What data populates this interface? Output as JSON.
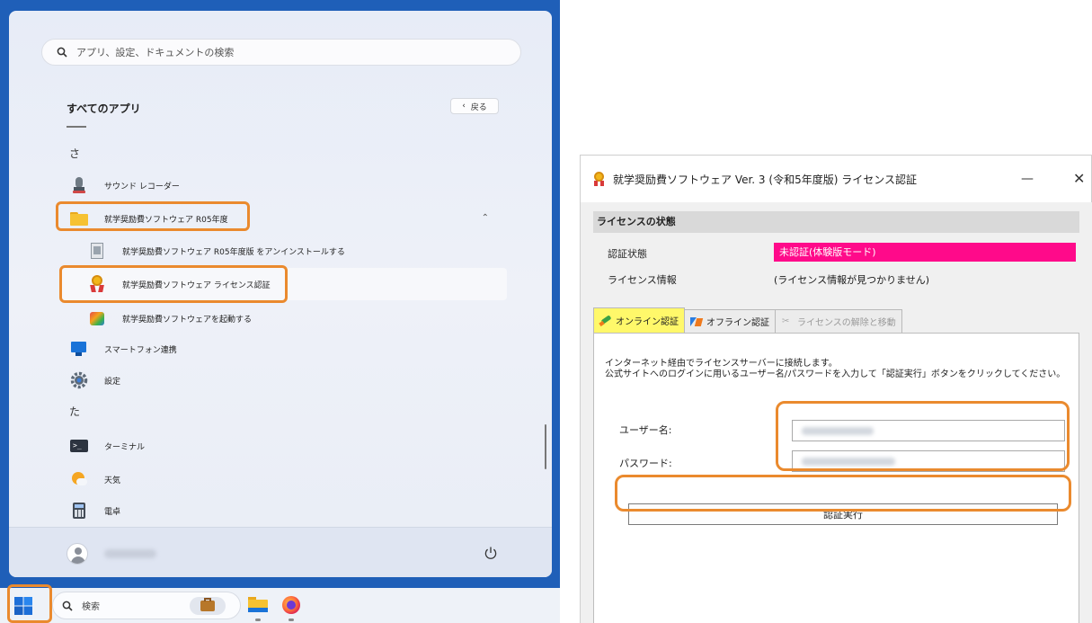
{
  "start_menu": {
    "search_placeholder": "アプリ、設定、ドキュメントの検索",
    "all_apps_title": "すべてのアプリ",
    "back_label": "戻る",
    "letters": [
      "さ",
      "た"
    ],
    "apps": {
      "sound_recorder": "サウンド レコーダー",
      "folder": "就学奨励費ソフトウェア R05年度",
      "uninstall": "就学奨励費ソフトウェア R05年度版 をアンインストールする",
      "license": "就学奨励費ソフトウェア ライセンス認証",
      "launch": "就学奨励費ソフトウェアを起動する",
      "phone_link": "スマートフォン連携",
      "settings": "設定",
      "terminal": "ターミナル",
      "weather": "天気",
      "calculator": "電卓"
    }
  },
  "taskbar": {
    "search_label": "検索"
  },
  "dialog": {
    "title": "就学奨励費ソフトウェア Ver. 3 (令和5年度版) ライセンス認証",
    "section_header": "ライセンスの状態",
    "auth_status_label": "認証状態",
    "auth_status_value": "未認証(体験版モード)",
    "license_info_label": "ライセンス情報",
    "license_info_value": "(ライセンス情報が見つかりません)",
    "tabs": [
      "オンライン認証",
      "オフライン認証",
      "ライセンスの解除と移動"
    ],
    "description": "インターネット経由でライセンスサーバーに接続します。\n公式サイトへのログインに用いるユーザー名/パスワードを入力して「認証実行」ボタンをクリックしてください。",
    "username_label": "ユーザー名:",
    "password_label": "パスワード:",
    "execute_button": "認証実行"
  },
  "colors": {
    "callout": "#ea8a2e",
    "status_bg": "#ff0a8a",
    "active_tab": "#fff86a",
    "desktop": "#1f5fb8"
  }
}
